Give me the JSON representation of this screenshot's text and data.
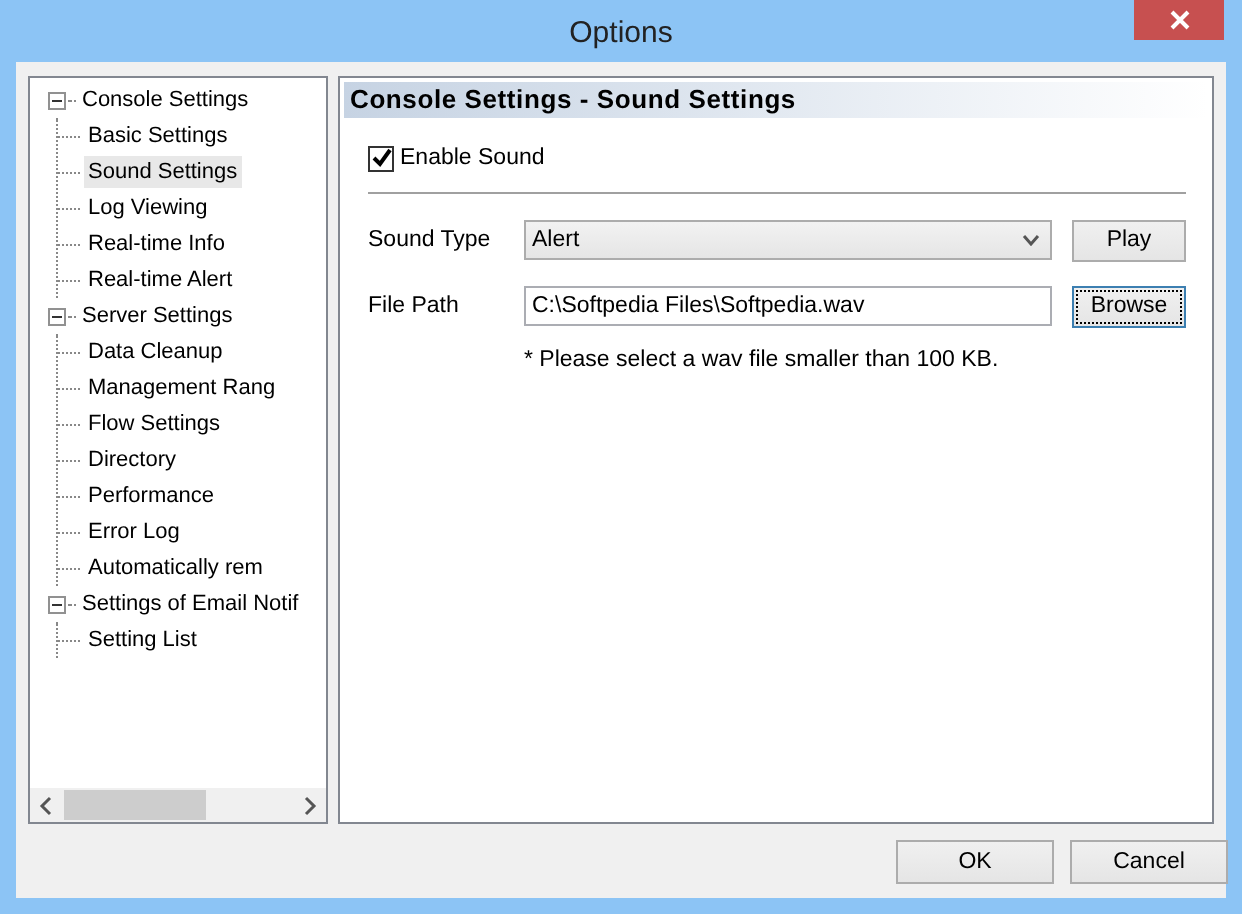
{
  "window": {
    "title": "Options"
  },
  "tree": [
    {
      "label": "Console Settings",
      "expanded": true,
      "selected": false,
      "children": [
        {
          "label": "Basic Settings",
          "selected": false
        },
        {
          "label": "Sound Settings",
          "selected": true
        },
        {
          "label": "Log Viewing",
          "selected": false
        },
        {
          "label": "Real-time Info",
          "selected": false
        },
        {
          "label": "Real-time Alert",
          "selected": false
        }
      ]
    },
    {
      "label": "Server Settings",
      "expanded": true,
      "selected": false,
      "children": [
        {
          "label": "Data Cleanup",
          "selected": false
        },
        {
          "label": "Management Rang",
          "selected": false
        },
        {
          "label": "Flow Settings",
          "selected": false
        },
        {
          "label": "Directory",
          "selected": false
        },
        {
          "label": "Performance",
          "selected": false
        },
        {
          "label": "Error Log",
          "selected": false
        },
        {
          "label": "Automatically rem",
          "selected": false
        }
      ]
    },
    {
      "label": "Settings of Email Notif",
      "expanded": true,
      "selected": false,
      "children": [
        {
          "label": "Setting List",
          "selected": false
        }
      ]
    }
  ],
  "panel": {
    "title": "Console Settings - Sound Settings",
    "enable_sound": {
      "label": "Enable Sound",
      "checked": true
    },
    "sound_type": {
      "label": "Sound Type",
      "value": "Alert",
      "button": "Play"
    },
    "file_path": {
      "label": "File Path",
      "value": "C:\\Softpedia Files\\Softpedia.wav",
      "button": "Browse"
    },
    "note": "* Please select a wav file smaller than 100 KB."
  },
  "buttons": [
    "OK",
    "Cancel"
  ]
}
